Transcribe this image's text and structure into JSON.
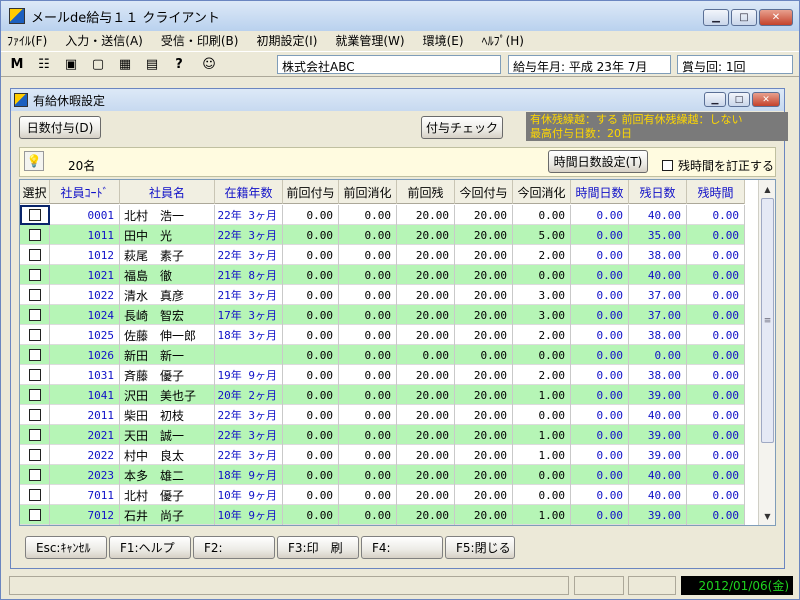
{
  "window": {
    "title": "メールde給与１１ クライアント"
  },
  "menu": [
    "ﾌｧｲﾙ(F)",
    "入力・送信(A)",
    "受信・印刷(B)",
    "初期設定(I)",
    "就業管理(W)",
    "環境(E)",
    "ﾍﾙﾌﾟ(H)"
  ],
  "toolbar": {
    "icons": [
      {
        "name": "mail-m-icon",
        "glyph": "M"
      },
      {
        "name": "list-icon",
        "glyph": "☷"
      },
      {
        "name": "monitor-icon",
        "glyph": "▣"
      },
      {
        "name": "screen-icon",
        "glyph": "▢"
      },
      {
        "name": "palette-icon",
        "glyph": "▦"
      },
      {
        "name": "printer-icon",
        "glyph": "▤"
      },
      {
        "name": "help-icon",
        "glyph": "?"
      },
      {
        "name": "mascot-icon",
        "glyph": "☺"
      }
    ],
    "company": "株式会社ABC",
    "pay_period": "給与年月: 平成 23年  7月",
    "bonus": "賞与回: 1回"
  },
  "child": {
    "title": "有給休暇設定",
    "grant_days_button": "日数付与(D)",
    "grant_check_button": "付与チェック",
    "status_line1": "有休残繰越：する  前回有休残繰越：しない",
    "status_line2": "最高付与日数：20日",
    "count": "20名",
    "hours_setting_button": "時間日数設定(T)",
    "correct_hours_label": "残時間を訂正する"
  },
  "table": {
    "headers": [
      "選択",
      "社員ｺｰﾄﾞ",
      "社員名",
      "在籍年数",
      "前回付与",
      "前回消化",
      "前回残",
      "今回付与",
      "今回消化",
      "時間日数",
      "残日数",
      "残時間"
    ],
    "rows": [
      [
        "0001",
        "北村　浩一",
        "22年 3ヶ月",
        "0.00",
        "0.00",
        "20.00",
        "20.00",
        "0.00",
        "0.00",
        "40.00",
        "0.00"
      ],
      [
        "1011",
        "田中　光",
        "22年 3ヶ月",
        "0.00",
        "0.00",
        "20.00",
        "20.00",
        "5.00",
        "0.00",
        "35.00",
        "0.00"
      ],
      [
        "1012",
        "萩尾　素子",
        "22年 3ヶ月",
        "0.00",
        "0.00",
        "20.00",
        "20.00",
        "2.00",
        "0.00",
        "38.00",
        "0.00"
      ],
      [
        "1021",
        "福島　徹",
        "21年 8ヶ月",
        "0.00",
        "0.00",
        "20.00",
        "20.00",
        "0.00",
        "0.00",
        "40.00",
        "0.00"
      ],
      [
        "1022",
        "清水　真彦",
        "21年 3ヶ月",
        "0.00",
        "0.00",
        "20.00",
        "20.00",
        "3.00",
        "0.00",
        "37.00",
        "0.00"
      ],
      [
        "1024",
        "長崎　智宏",
        "17年 3ヶ月",
        "0.00",
        "0.00",
        "20.00",
        "20.00",
        "3.00",
        "0.00",
        "37.00",
        "0.00"
      ],
      [
        "1025",
        "佐藤　伸一郎",
        "18年 3ヶ月",
        "0.00",
        "0.00",
        "20.00",
        "20.00",
        "2.00",
        "0.00",
        "38.00",
        "0.00"
      ],
      [
        "1026",
        "新田　新一",
        "",
        "0.00",
        "0.00",
        "0.00",
        "0.00",
        "0.00",
        "0.00",
        "0.00",
        "0.00"
      ],
      [
        "1031",
        "斉藤　優子",
        "19年 9ヶ月",
        "0.00",
        "0.00",
        "20.00",
        "20.00",
        "2.00",
        "0.00",
        "38.00",
        "0.00"
      ],
      [
        "1041",
        "沢田　美也子",
        "20年 2ヶ月",
        "0.00",
        "0.00",
        "20.00",
        "20.00",
        "1.00",
        "0.00",
        "39.00",
        "0.00"
      ],
      [
        "2011",
        "柴田　初枝",
        "22年 3ヶ月",
        "0.00",
        "0.00",
        "20.00",
        "20.00",
        "0.00",
        "0.00",
        "40.00",
        "0.00"
      ],
      [
        "2021",
        "天田　誠一",
        "22年 3ヶ月",
        "0.00",
        "0.00",
        "20.00",
        "20.00",
        "1.00",
        "0.00",
        "39.00",
        "0.00"
      ],
      [
        "2022",
        "村中　良太",
        "22年 3ヶ月",
        "0.00",
        "0.00",
        "20.00",
        "20.00",
        "1.00",
        "0.00",
        "39.00",
        "0.00"
      ],
      [
        "2023",
        "本多　雄二",
        "18年 9ヶ月",
        "0.00",
        "0.00",
        "20.00",
        "20.00",
        "0.00",
        "0.00",
        "40.00",
        "0.00"
      ],
      [
        "7011",
        "北村　優子",
        "10年 9ヶ月",
        "0.00",
        "0.00",
        "20.00",
        "20.00",
        "0.00",
        "0.00",
        "40.00",
        "0.00"
      ],
      [
        "7012",
        "石井　尚子",
        "10年 9ヶ月",
        "0.00",
        "0.00",
        "20.00",
        "20.00",
        "1.00",
        "0.00",
        "39.00",
        "0.00"
      ]
    ]
  },
  "fkeys": [
    "Esc:ｷｬﾝｾﾙ",
    "F1:ヘルプ",
    "F2:",
    "F3:印　刷",
    "F4:",
    "F5:閉じる"
  ],
  "status": {
    "date": "2012/01/06(金)"
  },
  "colors": {
    "stripe": "#b6f5b6",
    "blue_text": "#1010c8",
    "status_bg": "#7a7a7a",
    "status_text": "#ffd800",
    "date_text": "#1ed21e"
  }
}
